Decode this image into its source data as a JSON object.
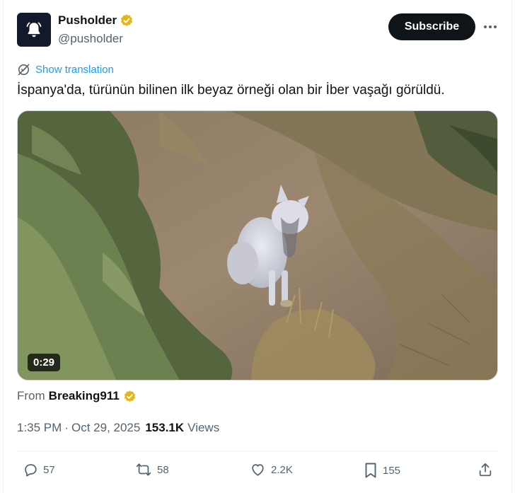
{
  "account": {
    "name": "Pusholder",
    "handle": "@pusholder",
    "verified": true,
    "verified_color": "#e2b719",
    "avatar_icon": "bell-icon"
  },
  "header": {
    "subscribe_label": "Subscribe",
    "more_icon": "more-horizontal-icon"
  },
  "translation": {
    "label": "Show translation",
    "icon": "translate-icon",
    "color": "#1d9bf0"
  },
  "tweet": {
    "text": "İspanya'da, türünün bilinen ilk beyaz örneği olan bir İber vaşağı görüldü."
  },
  "media": {
    "duration": "0:29"
  },
  "source": {
    "prefix": "From",
    "account": "Breaking911",
    "verified": true
  },
  "meta": {
    "time": "1:35 PM",
    "separator": "·",
    "date": "Oct 29, 2025",
    "views_count": "153.1K",
    "views_label": "Views"
  },
  "actions": {
    "replies": "57",
    "reposts": "58",
    "likes": "2.2K",
    "bookmarks": "155",
    "share_icon": "share-icon"
  }
}
